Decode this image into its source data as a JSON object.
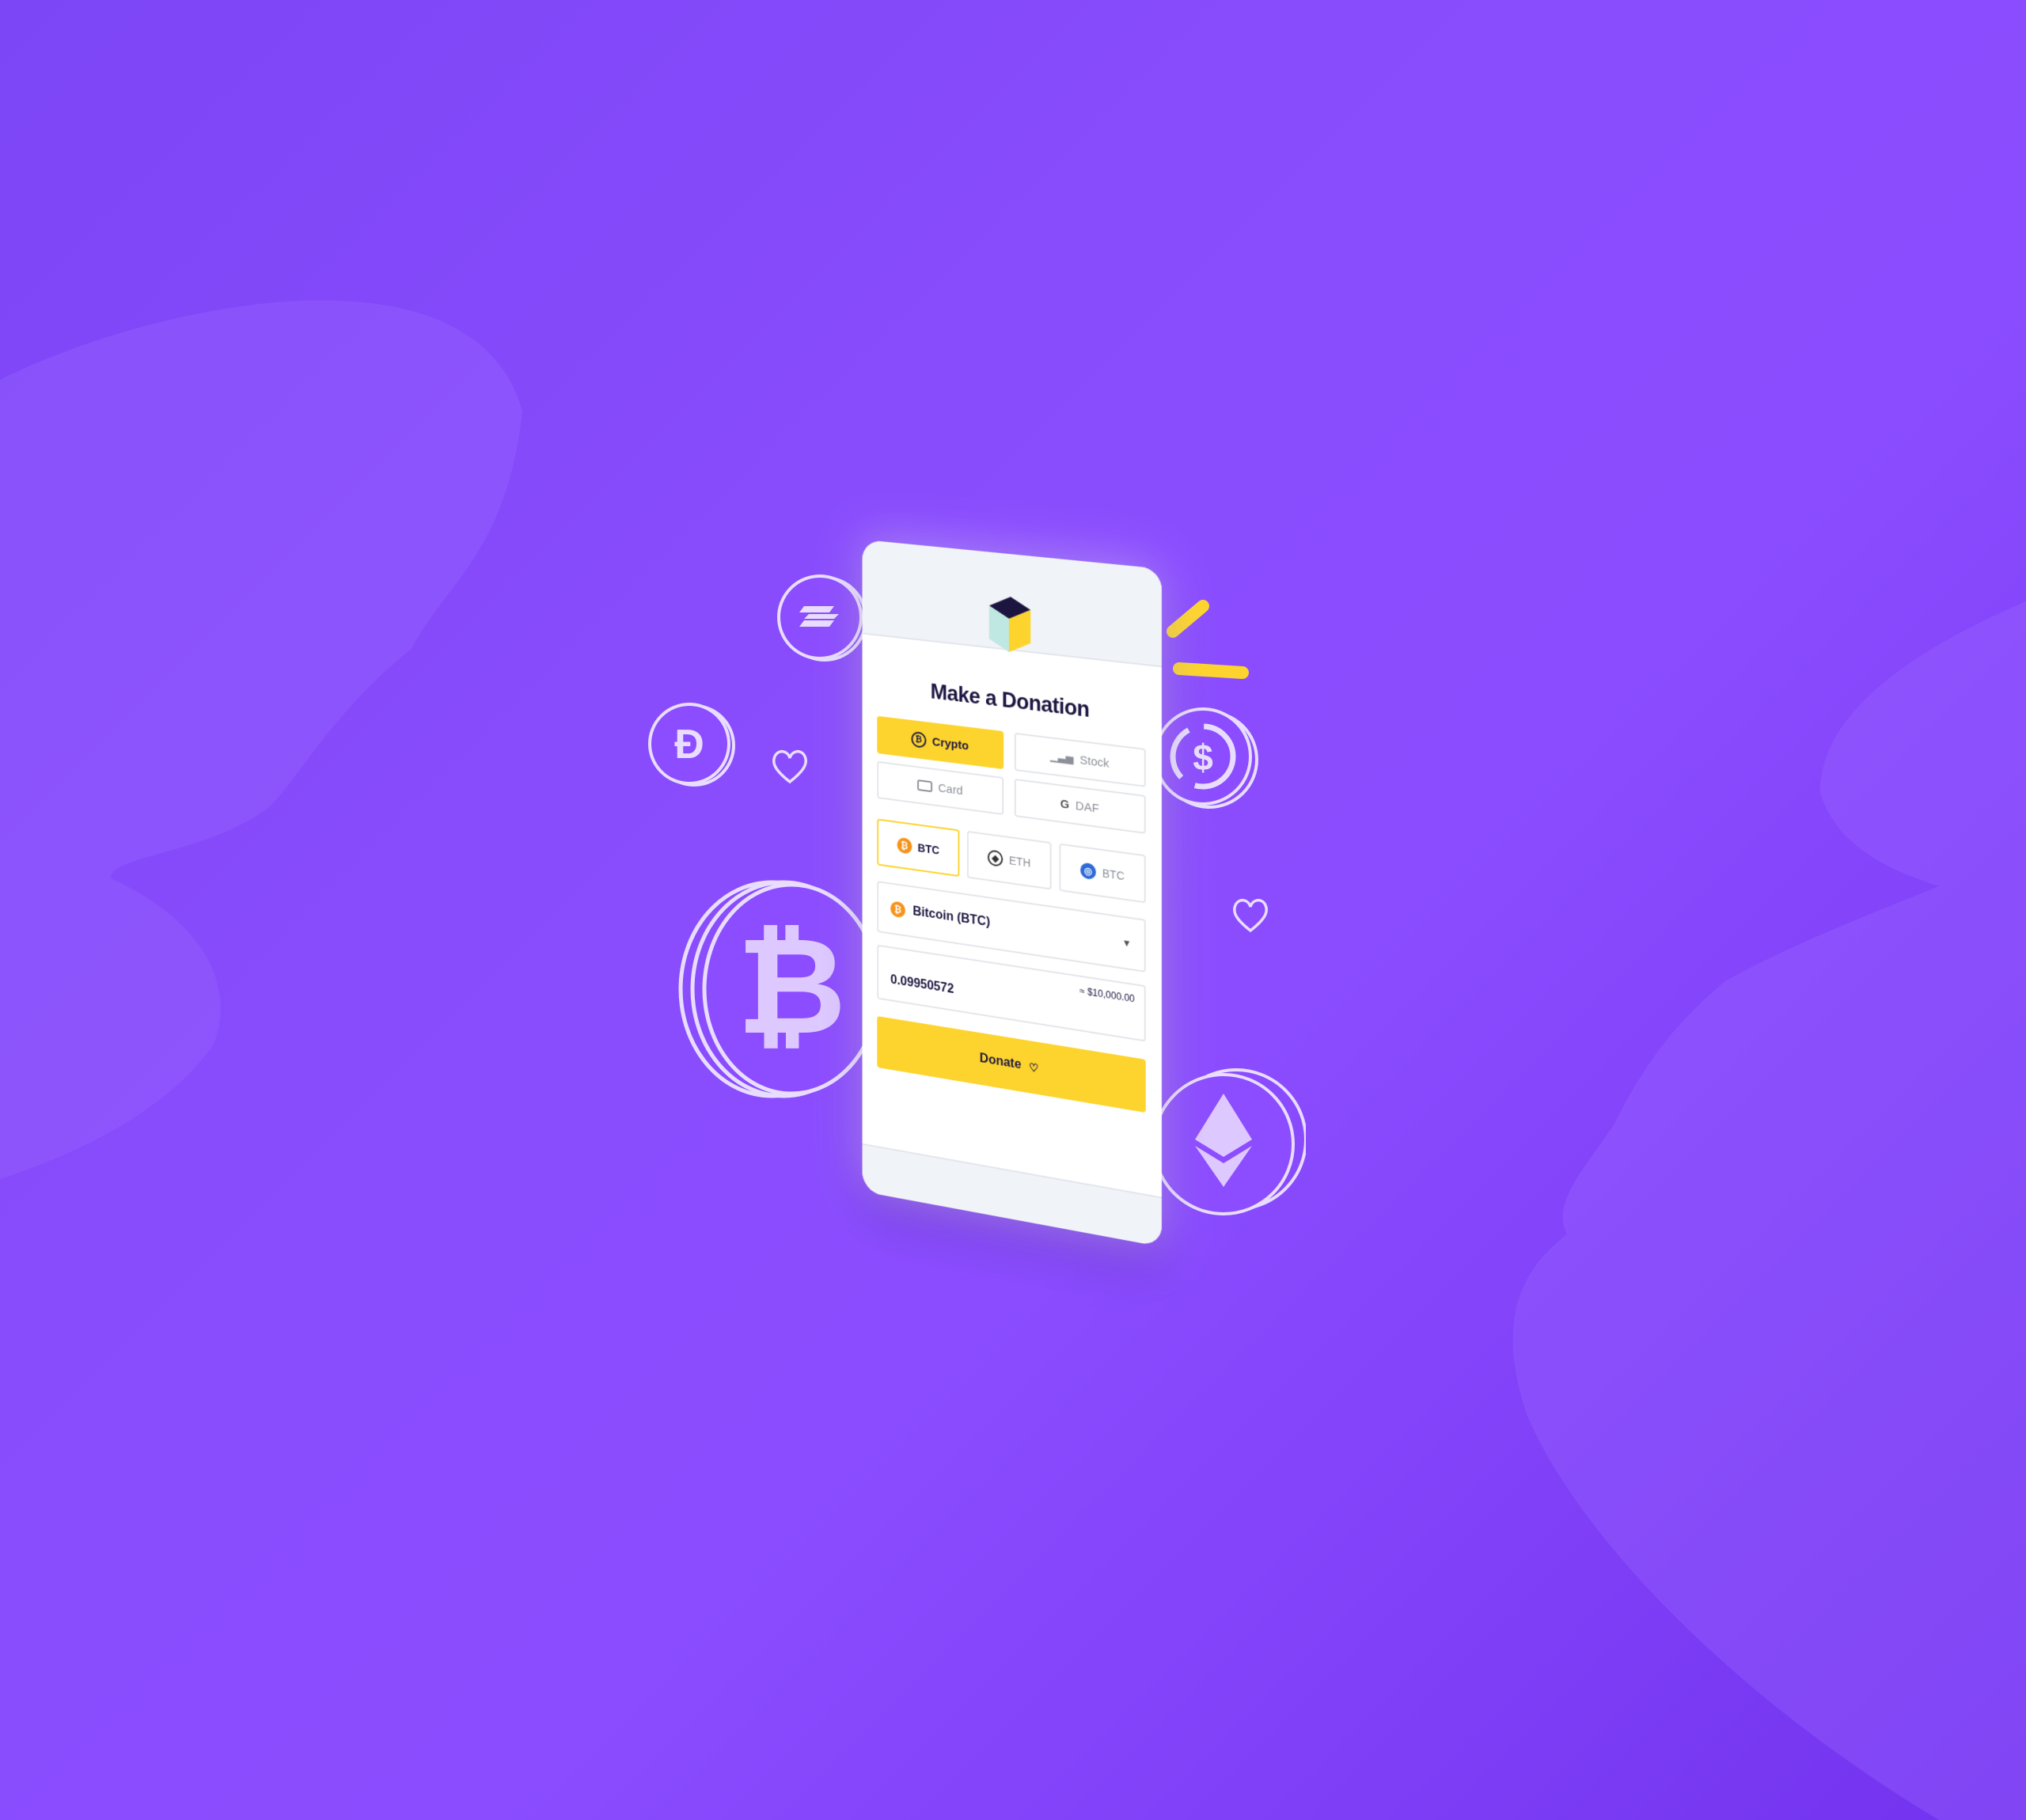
{
  "donation": {
    "title": "Make a Donation",
    "methods": [
      {
        "label": "Crypto",
        "icon": "bitcoin-outline-icon",
        "active": true
      },
      {
        "label": "Stock",
        "icon": "chart-bars-icon",
        "active": false
      },
      {
        "label": "Card",
        "icon": "credit-card-icon",
        "active": false
      },
      {
        "label": "DAF",
        "icon": "daf-logo-icon",
        "active": false
      }
    ],
    "coins": [
      {
        "label": "BTC",
        "icon": "bitcoin-icon",
        "active": true
      },
      {
        "label": "ETH",
        "icon": "ethereum-icon",
        "active": false
      },
      {
        "label": "BTC",
        "icon": "coin-blue-icon",
        "active": false
      }
    ],
    "selected_currency": "Bitcoin (BTC)",
    "amount_crypto": "0.09950572",
    "amount_usd": "≈ $10,000.00",
    "donate_label": "Donate"
  },
  "colors": {
    "background": "#8a4dfd",
    "accent": "#fdd42d",
    "text": "#1c1540",
    "bitcoin": "#f7931a"
  }
}
